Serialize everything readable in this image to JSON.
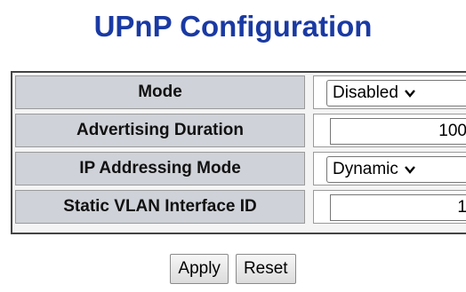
{
  "title": "UPnP Configuration",
  "rows": [
    {
      "label": "Mode",
      "type": "select",
      "value": "Disabled"
    },
    {
      "label": "Advertising Duration",
      "type": "input",
      "value": "100"
    },
    {
      "label": "IP Addressing Mode",
      "type": "select",
      "value": "Dynamic"
    },
    {
      "label": "Static VLAN Interface ID",
      "type": "input",
      "value": "1"
    }
  ],
  "buttons": {
    "apply": "Apply",
    "reset": "Reset"
  },
  "colors": {
    "title": "#1a3aa3",
    "label_bg": "#cfd2d8"
  },
  "icons": {
    "dropdown": "chevron-down-icon"
  }
}
